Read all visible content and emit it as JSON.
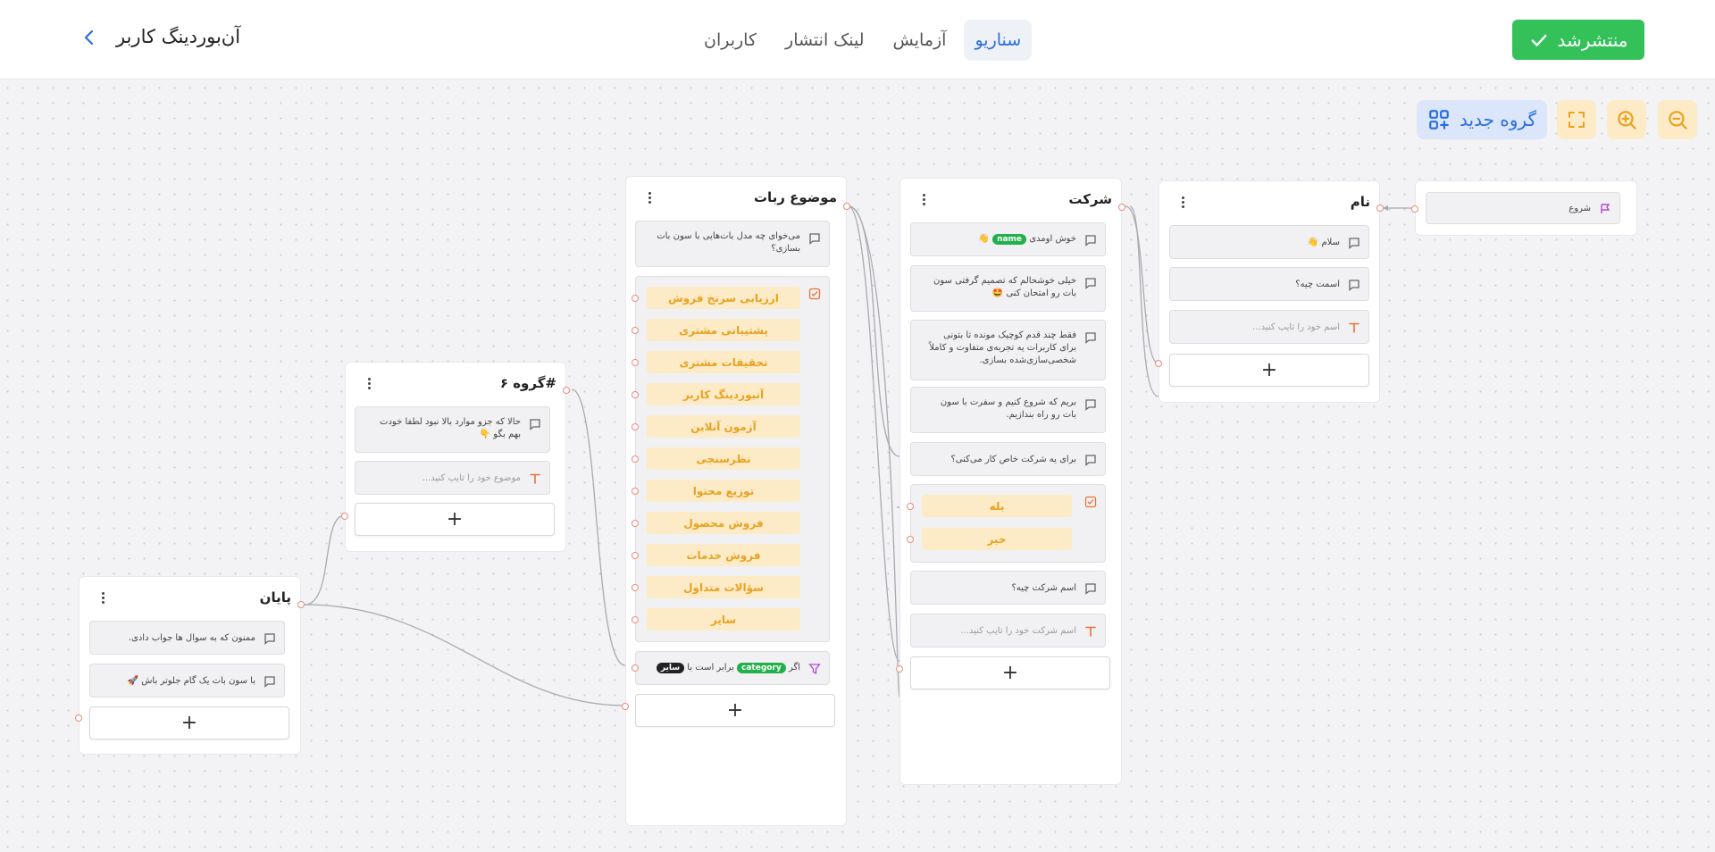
{
  "header": {
    "title": "آن‌بوردینگ کاربر",
    "tabs": [
      {
        "label": "سناریو",
        "active": true
      },
      {
        "label": "آزمایش",
        "active": false
      },
      {
        "label": "لینک انتشار",
        "active": false
      },
      {
        "label": "کاربران",
        "active": false
      }
    ],
    "publish_label": "منتشرشد",
    "publish_icon": "check-icon",
    "back_icon": "chevron-left-icon"
  },
  "toolbar": {
    "new_group_label": "گروه جدید",
    "tools": [
      "zoom-out-icon",
      "zoom-in-icon",
      "fit-view-icon",
      "add-group-icon"
    ]
  },
  "nodes": {
    "start": {
      "label": "شروع"
    },
    "name": {
      "title": "نام",
      "messages": [
        "سلام 👋",
        "اسمت چیه؟"
      ],
      "input_placeholder": "اسم خود را تایپ کنید..."
    },
    "company": {
      "title": "شرکت",
      "welcome_prefix": "خوش اومدی",
      "welcome_var": "name",
      "welcome_suffix": "👋",
      "messages": [
        "خیلی خوشحالم که تصمیم گرفتی سون بات رو امتحان کنی 🤩",
        "فقط چند قدم کوچیک مونده تا بتونی برای کاربرات یه تجربه‌ی متفاوت و کاملاً شخصی‌سازی‌شده بسازی.",
        "بریم که شروع کنیم و سفرت با سون بات رو راه بندازیم.",
        "برای یه شرکت خاص کار می‌کنی؟"
      ],
      "choices": [
        "بله",
        "خیر"
      ],
      "question": "اسم شرکت چیه؟",
      "input_placeholder": "اسم شرکت خود را تایپ کنید..."
    },
    "topic": {
      "title": "موضوع ربات",
      "question": "می‌خوای چه مدل بات‌هایی با سون بات بسازی؟",
      "choices": [
        "ارزیابی سرنخ فروش",
        "پشتیبانی مشتری",
        "تحقیقات مشتری",
        "آنبوردینگ کاربر",
        "آزمون آنلاین",
        "نظرسنجی",
        "توزیع محتوا",
        "فروش محصول",
        "فروش خدمات",
        "سؤالات متداول",
        "سایر"
      ],
      "condition_if": "اگر",
      "condition_var": "category",
      "condition_op": "برابر است با",
      "condition_value": "سایر"
    },
    "group6": {
      "title": "#گروه ۶",
      "message": "حالا که جزو موارد بالا نبود لطفا خودت بهم بگو 👇",
      "input_placeholder": "موضوع خود را تایپ کنید..."
    },
    "end": {
      "title": "پایان",
      "messages": [
        "ممنون که به سوال ها جواب دادی.",
        "با سون بات یک گام جلوتر باش 🚀"
      ]
    }
  },
  "colors": {
    "accent": "#2b6de0",
    "publish": "#34c15a",
    "choice_bg": "#fdebc8",
    "choice_text": "#e8a21e",
    "tool_bg": "#fdebc8",
    "var_tag": "#22b04b"
  }
}
